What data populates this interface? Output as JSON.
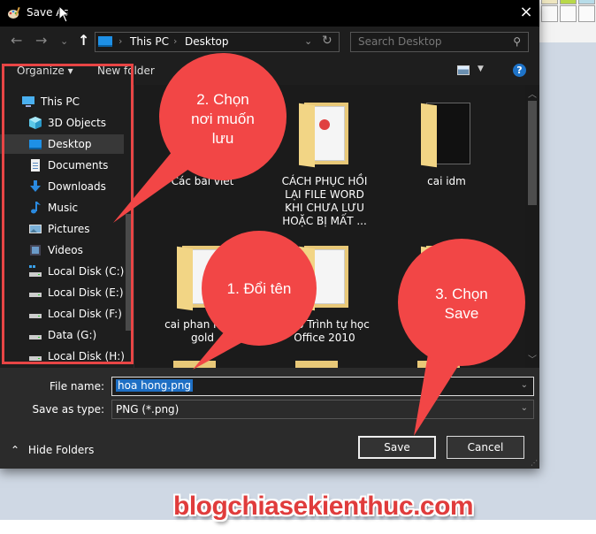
{
  "window": {
    "title": "Save As",
    "close_icon": "×"
  },
  "nav": {
    "back_icon": "←",
    "forward_icon": "→",
    "recent_icon": "⌄",
    "up_icon": "↑",
    "breadcrumb": [
      "This PC",
      "Desktop"
    ],
    "breadcrumb_sep": "›",
    "address_dropdown_icon": "⌄",
    "refresh_icon": "↻",
    "search_placeholder": "Search Desktop",
    "search_icon": "⚲"
  },
  "toolbar": {
    "organize_label": "Organize ▾",
    "new_folder_label": "New folder",
    "view_dropdown_icon": "▼",
    "help_icon": "?"
  },
  "sidebar": {
    "items": [
      {
        "label": "This PC",
        "icon": "pc-icon"
      },
      {
        "label": "3D Objects",
        "icon": "cube-icon"
      },
      {
        "label": "Desktop",
        "icon": "desktop-icon",
        "selected": true
      },
      {
        "label": "Documents",
        "icon": "document-icon"
      },
      {
        "label": "Downloads",
        "icon": "download-icon"
      },
      {
        "label": "Music",
        "icon": "music-icon"
      },
      {
        "label": "Pictures",
        "icon": "pictures-icon"
      },
      {
        "label": "Videos",
        "icon": "videos-icon"
      },
      {
        "label": "Local Disk (C:)",
        "icon": "system-drive-icon"
      },
      {
        "label": "Local Disk (E:)",
        "icon": "drive-icon"
      },
      {
        "label": "Local Disk (F:)",
        "icon": "drive-icon"
      },
      {
        "label": "Data (G:)",
        "icon": "drive-icon"
      },
      {
        "label": "Local Disk (H:)",
        "icon": "drive-icon"
      }
    ]
  },
  "files": [
    {
      "label": "Các bài viết"
    },
    {
      "label": "CÁCH PHỤC HỒI LẠI FILE WORD KHI CHƯA LƯU HOẶC BỊ MẤT ..."
    },
    {
      "label": "cai idm"
    },
    {
      "label": "cai phan mem gold"
    },
    {
      "label": "Giáo Trình tự học Office 2010"
    },
    {
      "label": ""
    }
  ],
  "form": {
    "file_name_label": "File name:",
    "file_name_value": "hoa hong.png",
    "save_type_label": "Save as type:",
    "save_type_value": "PNG (*.png)",
    "dropdown_icon": "⌄",
    "hide_folders_label": "Hide Folders",
    "hide_folders_icon": "⌃",
    "save_label": "Save",
    "cancel_label": "Cancel"
  },
  "annotations": {
    "step1": "1. Đổi tên",
    "step2_line1": "2. Chọn",
    "step2_line2": "nơi muốn",
    "step2_line3": "lưu",
    "step3_line1": "3. Chọn",
    "step3_line2": "Save",
    "color": "#f24646",
    "watermark": "blogchiasekienthuc.com"
  }
}
